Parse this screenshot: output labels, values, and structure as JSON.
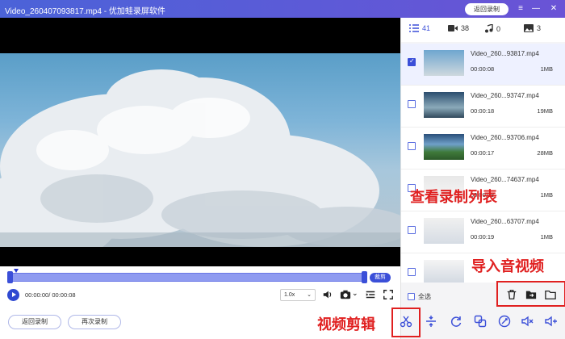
{
  "window": {
    "title": "Video_260407093817.mp4 - 优加蛙录屏软件",
    "back_to_record_label": "返回录制"
  },
  "player": {
    "cut_label": "裁剪",
    "time_display": "00:00:00/ 00:00:08",
    "speed_value": "1.0x"
  },
  "footer": {
    "back_record_label": "返回录制",
    "record_again_label": "再次录制"
  },
  "panel": {
    "tabs": [
      {
        "icon": "list-icon",
        "count": "41"
      },
      {
        "icon": "video-icon",
        "count": "38"
      },
      {
        "icon": "music-icon",
        "count": "0"
      },
      {
        "icon": "image-icon",
        "count": "3"
      }
    ],
    "files": [
      {
        "name": "Video_260...93817.mp4",
        "duration": "00:00:08",
        "size": "1MB",
        "selected": true
      },
      {
        "name": "Video_260...93747.mp4",
        "duration": "00:00:18",
        "size": "19MB",
        "selected": false
      },
      {
        "name": "Video_260...93706.mp4",
        "duration": "00:00:17",
        "size": "28MB",
        "selected": false
      },
      {
        "name": "Video_260...74637.mp4",
        "duration": "00:00:08",
        "size": "1MB",
        "selected": false
      },
      {
        "name": "Video_260...63707.mp4",
        "duration": "00:00:19",
        "size": "1MB",
        "selected": false
      },
      {
        "name": "",
        "duration": "",
        "size": "",
        "selected": false
      }
    ],
    "select_all_label": "全选"
  },
  "annotations": {
    "list_label": "查看录制列表",
    "import_label": "导入音视频",
    "edit_label": "视频剪辑"
  },
  "colors": {
    "accent": "#3b4fd8",
    "highlight": "#e02020"
  }
}
